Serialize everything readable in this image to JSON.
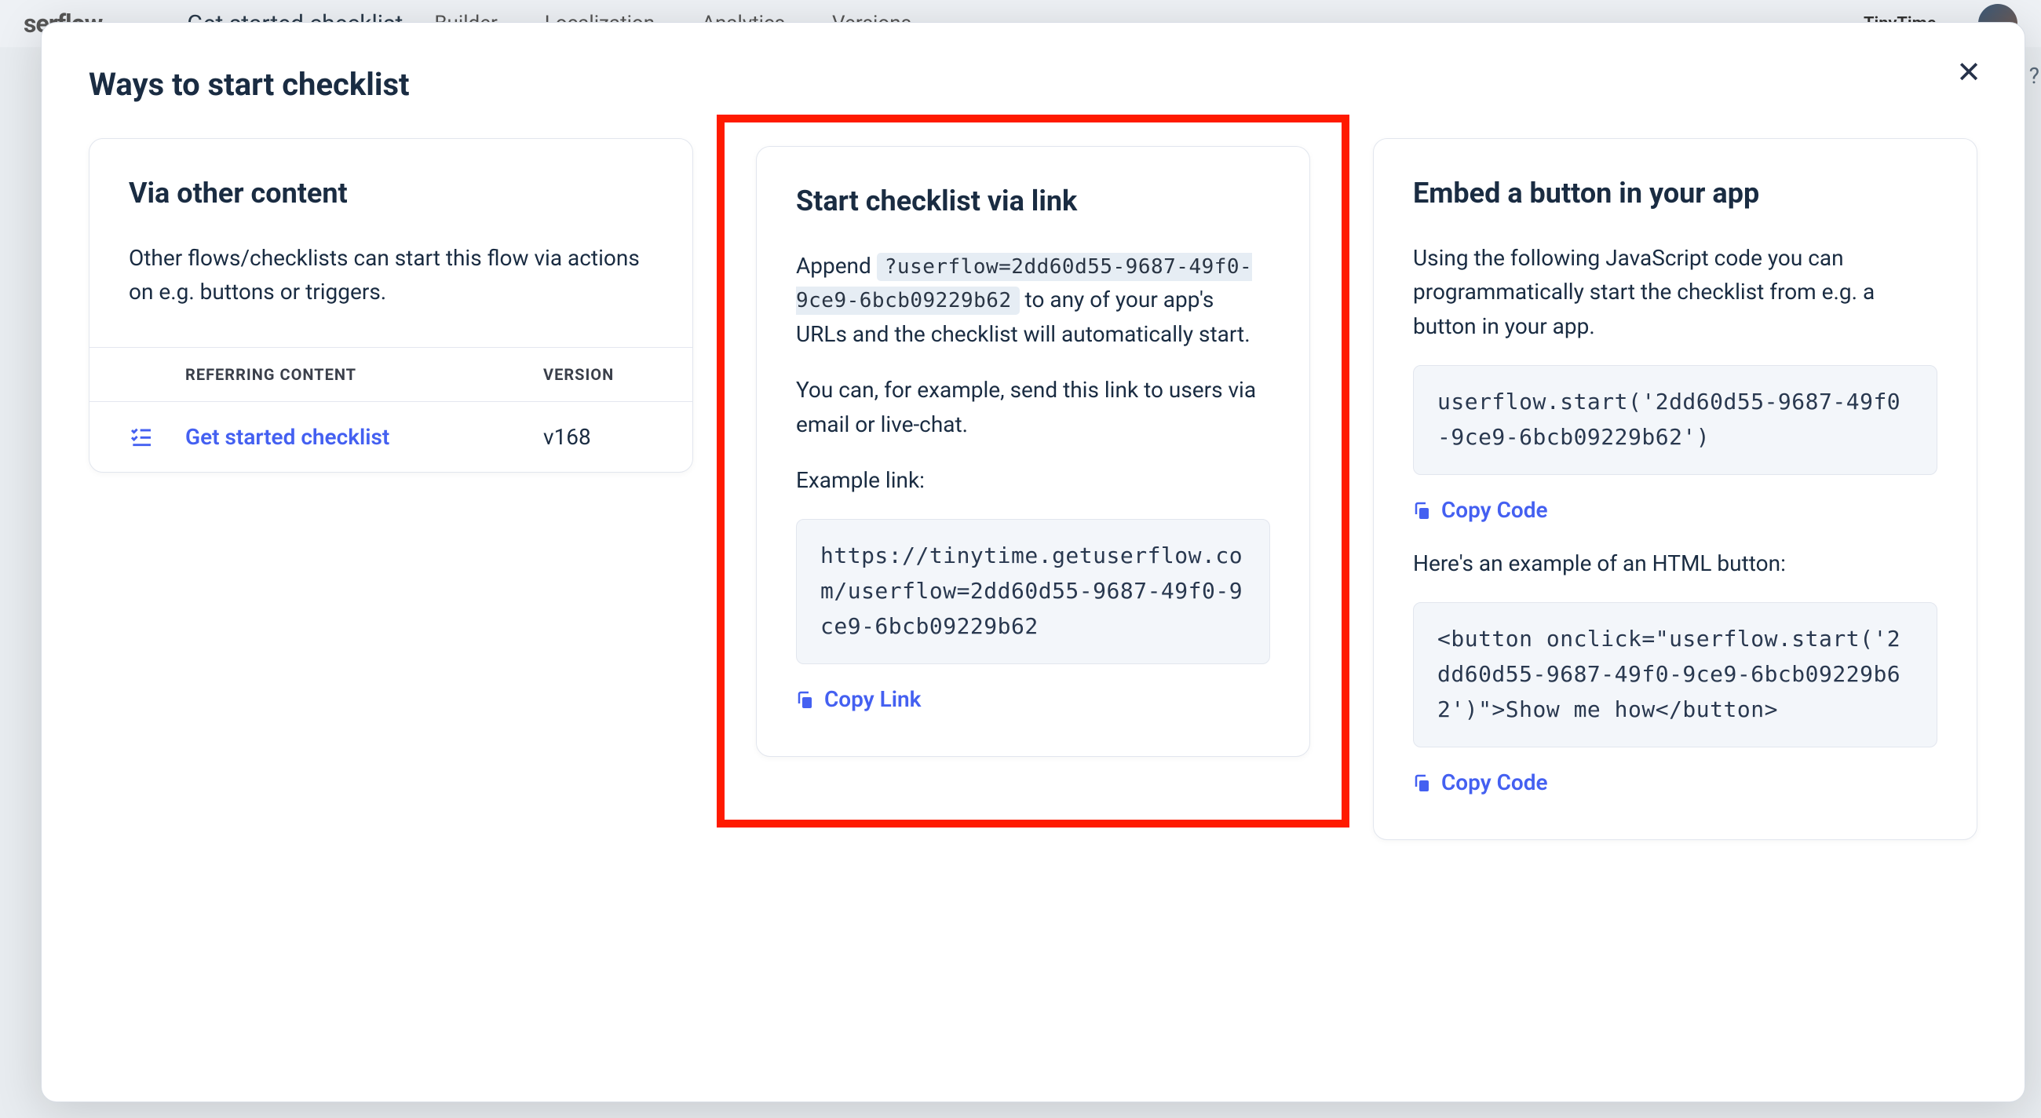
{
  "header": {
    "logo": "serflow",
    "title": "Get started checklist",
    "nav": [
      "Builder",
      "Localization",
      "Analytics",
      "Versions"
    ],
    "workspace": "TinyTime"
  },
  "modal": {
    "title": "Ways to start checklist",
    "close_label": "✕"
  },
  "card1": {
    "title": "Via other content",
    "description": "Other flows/checklists can start this flow via actions on e.g. buttons or triggers.",
    "table": {
      "col_content": "REFERRING CONTENT",
      "col_version": "VERSION",
      "rows": [
        {
          "name": "Get started checklist",
          "version": "v168"
        }
      ]
    }
  },
  "card2": {
    "title": "Start checklist via link",
    "append_prefix": "Append ",
    "append_code": "?userflow=2dd60d55-9687-49f0-9ce9-6bcb09229b62",
    "append_suffix": " to any of your app's URLs and the checklist will automatically start.",
    "line2": "You can, for example, send this link to users via email or live-chat.",
    "example_label": "Example link:",
    "example_link": "https://tinytime.getuserflow.com/userflow=2dd60d55-9687-49f0-9ce9-6bcb09229b62",
    "copy_label": "Copy Link"
  },
  "card3": {
    "title": "Embed a button in your app",
    "description": "Using the following JavaScript code you can programmatically start the checklist from e.g. a button in your app.",
    "code_js": "userflow.start('2dd60d55-9687-49f0-9ce9-6bcb09229b62')",
    "copy_code_label": "Copy Code",
    "html_intro": "Here's an example of an HTML button:",
    "code_html": "<button onclick=\"userflow.start('2dd60d55-9687-49f0-9ce9-6bcb09229b62')\">Show me how</button>"
  },
  "help": "?"
}
